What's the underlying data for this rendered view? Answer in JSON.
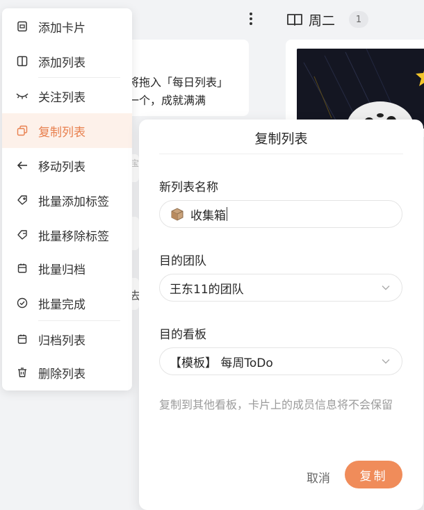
{
  "board": {
    "card_line_1": "将拖入「每日列表」",
    "card_line_2": "一个，成就满满",
    "card_fragment_small": "宝",
    "card_fragment_4": "去"
  },
  "column": {
    "title": "周二",
    "count": "1"
  },
  "menu": {
    "items": [
      {
        "label": "添加卡片",
        "icon": "card-icon"
      },
      {
        "label": "添加列表",
        "icon": "split-column-icon"
      },
      {
        "label": "关注列表",
        "icon": "eye-closed-icon"
      },
      {
        "label": "复制列表",
        "icon": "copy-icon"
      },
      {
        "label": "移动列表",
        "icon": "arrow-left-icon"
      },
      {
        "label": "批量添加标签",
        "icon": "tag-add-icon"
      },
      {
        "label": "批量移除标签",
        "icon": "tag-remove-icon"
      },
      {
        "label": "批量归档",
        "icon": "archive-icon"
      },
      {
        "label": "批量完成",
        "icon": "check-circle-icon"
      },
      {
        "label": "归档列表",
        "icon": "archive-icon"
      },
      {
        "label": "删除列表",
        "icon": "trash-icon"
      }
    ],
    "active_color": "#e8804f"
  },
  "dialog": {
    "title": "复制列表",
    "name_label": "新列表名称",
    "name_value": "收集箱",
    "team_label": "目的团队",
    "team_value": "王东11的团队",
    "board_label": "目的看板",
    "board_value": "【模板】 每周ToDo",
    "hint": "复制到其他看板，卡片上的成员信息将不会保留",
    "cancel_label": "取消",
    "confirm_label": "复制",
    "accent_color": "#f08c5a"
  }
}
